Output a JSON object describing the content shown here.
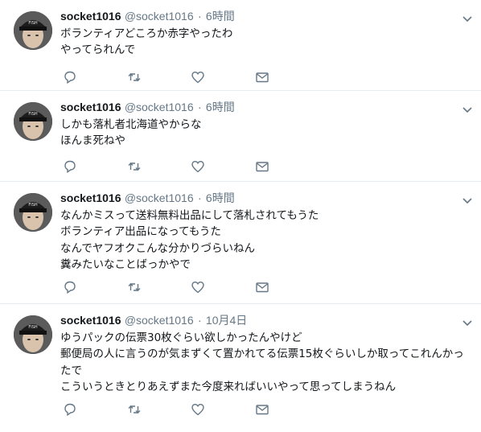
{
  "tweets": [
    {
      "fullname": "socket1016",
      "username": "@socket1016",
      "separator": "·",
      "time": "6時間",
      "lines": [
        "ボランティアどころか赤字やったわ",
        "やってられんで"
      ]
    },
    {
      "fullname": "socket1016",
      "username": "@socket1016",
      "separator": "·",
      "time": "6時間",
      "lines": [
        "しかも落札者北海道やからな",
        "ほんま死ねや"
      ]
    },
    {
      "fullname": "socket1016",
      "username": "@socket1016",
      "separator": "·",
      "time": "6時間",
      "lines": [
        "なんかミスって送料無料出品にして落札されてもうた",
        "ボランティア出品になってもうた",
        "なんでヤフオクこんな分かりづらいねん",
        "糞みたいなことばっかやで"
      ]
    },
    {
      "fullname": "socket1016",
      "username": "@socket1016",
      "separator": "·",
      "time": "10月4日",
      "lines": [
        "ゆうパックの伝票30枚ぐらい欲しかったんやけど",
        "郵便局の人に言うのが気まずくて置かれてる伝票15枚ぐらいしか取ってこれんかっ",
        "たで",
        "こういうときとりあえずまた今度来ればいいやって思ってしまうねん"
      ]
    }
  ],
  "colors": {
    "secondary_text": "#657786",
    "primary_text": "#14171a",
    "divider": "#e6ecf0",
    "icon": "#657786"
  },
  "icons": [
    "reply-icon",
    "retweet-icon",
    "like-icon",
    "dm-icon",
    "caret-down-icon"
  ]
}
